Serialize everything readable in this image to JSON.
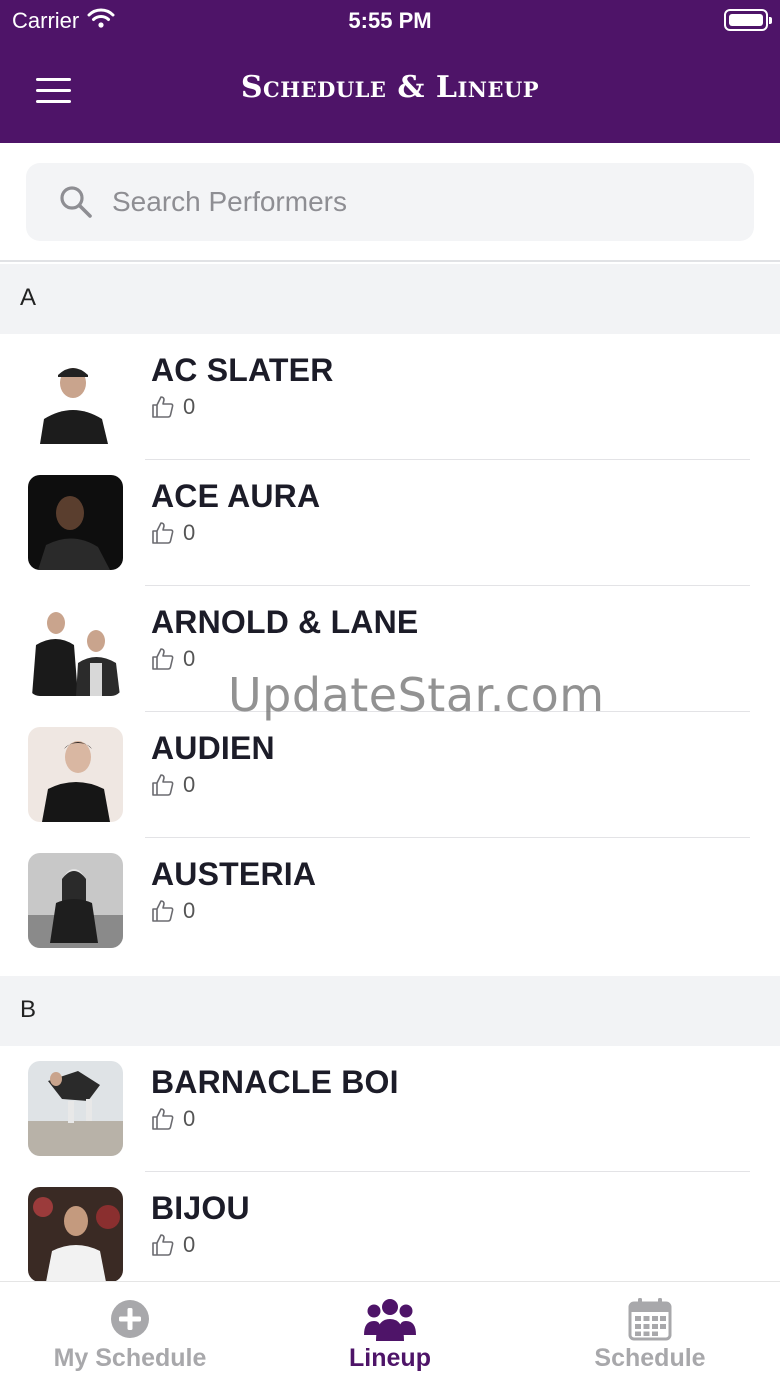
{
  "status_bar": {
    "carrier": "Carrier",
    "time": "5:55 PM"
  },
  "header": {
    "title": "Schedule & Lineup"
  },
  "search": {
    "placeholder": "Search Performers",
    "value": ""
  },
  "sections": [
    {
      "letter": "A",
      "performers": [
        {
          "name": "AC SLATER",
          "likes": "0"
        },
        {
          "name": "ACE AURA",
          "likes": "0"
        },
        {
          "name": "ARNOLD & LANE",
          "likes": "0"
        },
        {
          "name": "AUDIEN",
          "likes": "0"
        },
        {
          "name": "AUSTERIA",
          "likes": "0"
        }
      ]
    },
    {
      "letter": "B",
      "performers": [
        {
          "name": "BARNACLE BOI",
          "likes": "0"
        },
        {
          "name": "BIJOU",
          "likes": "0"
        }
      ]
    }
  ],
  "watermark": "UpdateStar.com",
  "tabs": [
    {
      "label": "My Schedule",
      "icon": "plus-circle-icon"
    },
    {
      "label": "Lineup",
      "icon": "users-icon"
    },
    {
      "label": "Schedule",
      "icon": "calendar-icon"
    }
  ],
  "colors": {
    "brand": "#4e1468",
    "section_bg": "#f2f3f5",
    "inactive_tab": "#a8a8ab"
  }
}
